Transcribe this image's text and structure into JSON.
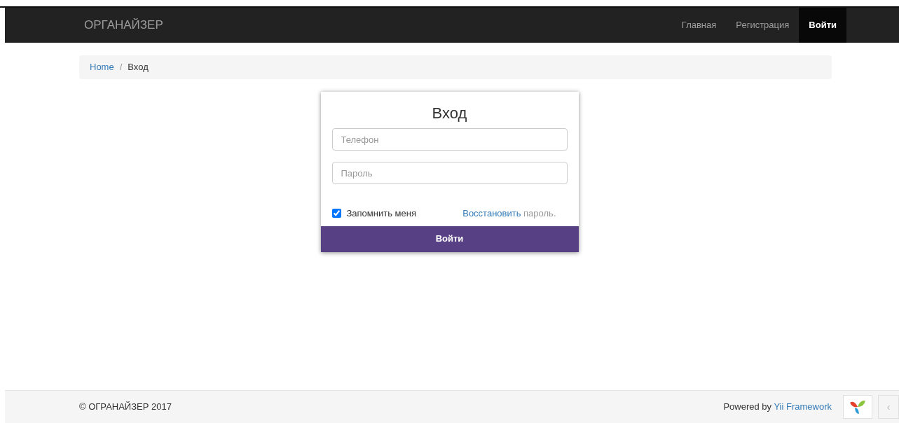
{
  "navbar": {
    "brand": "ОРГАНАЙЗЕР",
    "items": [
      {
        "label": "Главная",
        "selected": false
      },
      {
        "label": "Регистрация",
        "selected": false
      },
      {
        "label": "Войти",
        "selected": true
      }
    ]
  },
  "breadcrumb": [
    {
      "label": "Home",
      "link": true
    },
    {
      "label": "/",
      "link": false
    },
    {
      "label": "Вход",
      "link": false
    }
  ],
  "login": {
    "title": "Вход",
    "fields": [
      {
        "placeholder": "Телефон"
      },
      {
        "placeholder": "Пароль"
      }
    ],
    "remember": {
      "label": "Запомнить меня",
      "checked": true
    },
    "recover": {
      "link": "Восстановить",
      "rest": "пароль."
    },
    "submit": "Войти"
  },
  "footer": {
    "copyright": "© ОГРАНАЙЗЕР 2017",
    "powered": "Powered by",
    "framework": "Yii Framework",
    "toolbar_toggle": "‹"
  }
}
